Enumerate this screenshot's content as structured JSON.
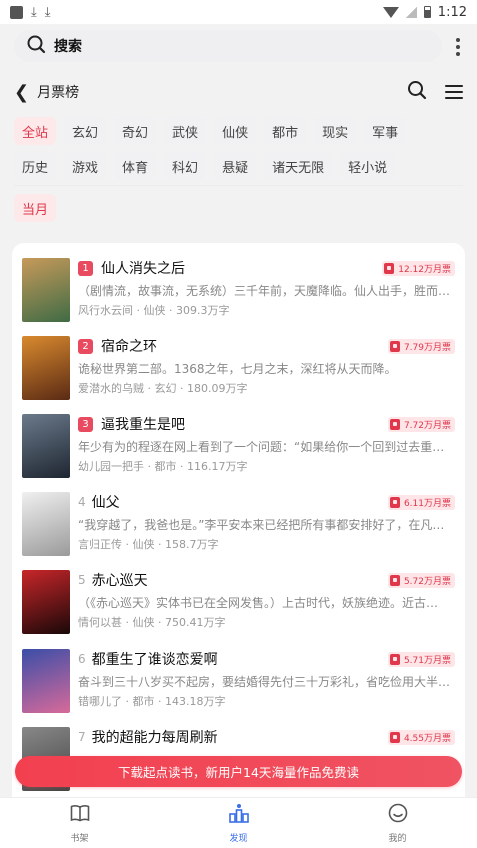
{
  "status_bar": {
    "time": "1:12"
  },
  "search": {
    "placeholder": "搜索"
  },
  "header": {
    "title": "月票榜"
  },
  "categories": [
    {
      "label": "全站",
      "active": true
    },
    {
      "label": "玄幻",
      "active": false
    },
    {
      "label": "奇幻",
      "active": false
    },
    {
      "label": "武侠",
      "active": false
    },
    {
      "label": "仙侠",
      "active": false
    },
    {
      "label": "都市",
      "active": false
    },
    {
      "label": "现实",
      "active": false
    },
    {
      "label": "军事",
      "active": false
    },
    {
      "label": "历史",
      "active": false
    },
    {
      "label": "游戏",
      "active": false
    },
    {
      "label": "体育",
      "active": false
    },
    {
      "label": "科幻",
      "active": false
    },
    {
      "label": "悬疑",
      "active": false
    },
    {
      "label": "诸天无限",
      "active": false
    },
    {
      "label": "轻小说",
      "active": false
    }
  ],
  "period": {
    "label": "当月"
  },
  "books": [
    {
      "rank": "1",
      "title": "仙人消失之后",
      "votes": "12.12万月票",
      "desc": "（剧情流，故事流，无系统）三千年前，天魔降临。仙人出手，胜而…",
      "meta": "风行水云间 · 仙侠 · 309.3万字",
      "c1": "#c79a5a",
      "c2": "#3f6b45"
    },
    {
      "rank": "2",
      "title": "宿命之环",
      "votes": "7.79万月票",
      "desc": "诡秘世界第二部。1368之年，七月之末，深红将从天而降。",
      "meta": "爱潜水的乌贼 · 玄幻 · 180.09万字",
      "c1": "#d98a2e",
      "c2": "#5a2a14"
    },
    {
      "rank": "3",
      "title": "逼我重生是吧",
      "votes": "7.72万月票",
      "desc": "年少有为的程逐在网上看到了一个问题：“如果给你一个回到过去重…",
      "meta": "幼儿园一把手 · 都市 · 116.17万字",
      "c1": "#6b7a8c",
      "c2": "#1e2630"
    },
    {
      "rank": "4",
      "title": "仙父",
      "votes": "6.11万月票",
      "desc": "“我穿越了，我爸也是。”李平安本来已经把所有事都安排好了，在凡…",
      "meta": "言归正传 · 仙侠 · 158.7万字",
      "c1": "#f0f0f0",
      "c2": "#9a9a9a"
    },
    {
      "rank": "5",
      "title": "赤心巡天",
      "votes": "5.72万月票",
      "desc": "（《赤心巡天》实体书已在全网发售。）上古时代，妖族绝迹。近古…",
      "meta": "情何以甚 · 仙侠 · 750.41万字",
      "c1": "#c8262a",
      "c2": "#1a0808"
    },
    {
      "rank": "6",
      "title": "都重生了谁谈恋爱啊",
      "votes": "5.71万月票",
      "desc": "奋斗到三十八岁买不起房，要结婚得先付三十万彩礼，省吃俭用大半…",
      "meta": "错哪儿了 · 都市 · 143.18万字",
      "c1": "#3a4ea8",
      "c2": "#d86a9a"
    },
    {
      "rank": "7",
      "title": "我的超能力每周刷新",
      "votes": "4.55万月票",
      "desc": "",
      "meta": "",
      "c1": "#888888",
      "c2": "#444444"
    }
  ],
  "banner": {
    "text": "下载起点读书，新用户14天海量作品免费读"
  },
  "bottom_nav": [
    {
      "label": "书架",
      "icon": "book-icon"
    },
    {
      "label": "发现",
      "icon": "discover-icon"
    },
    {
      "label": "我的",
      "icon": "smile-icon"
    }
  ]
}
